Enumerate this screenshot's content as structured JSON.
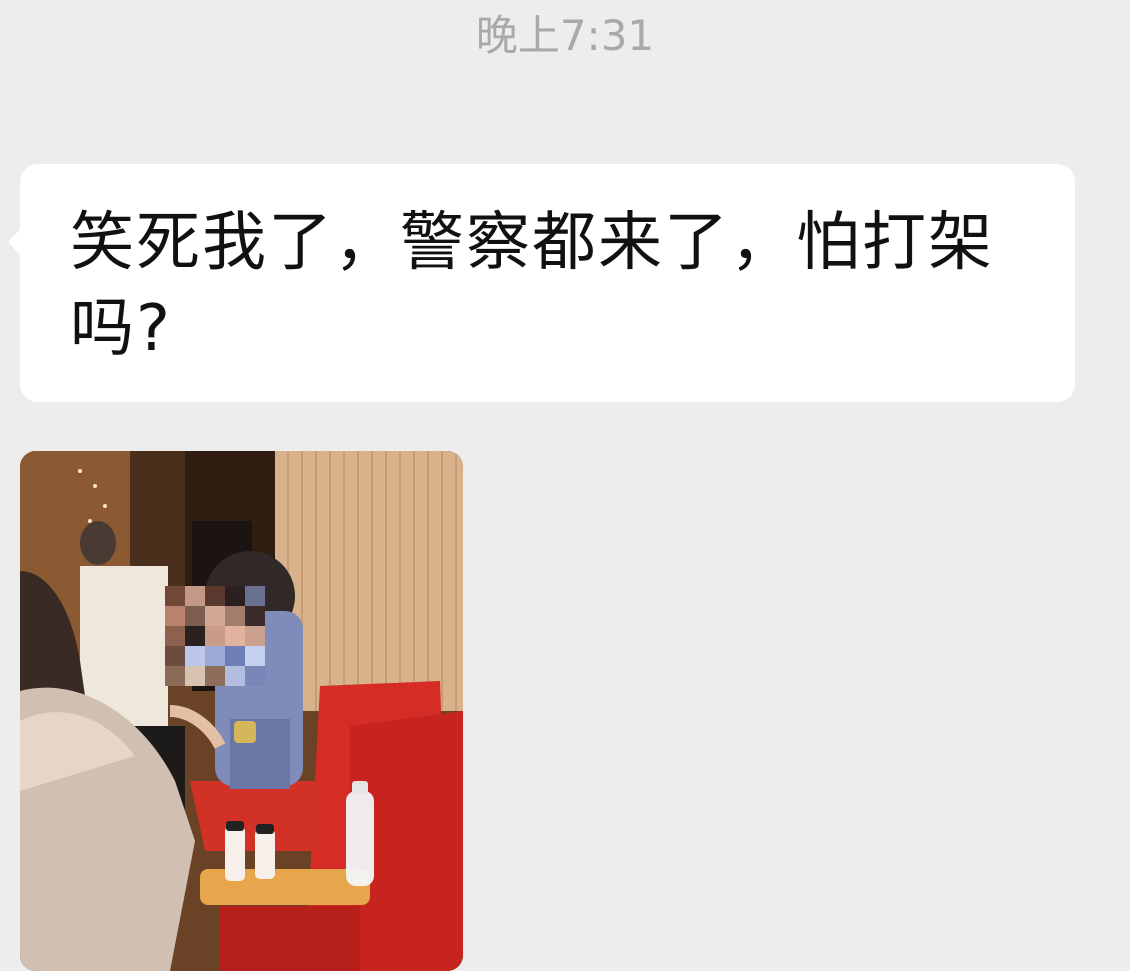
{
  "chat": {
    "timestamp": "晚上7:31",
    "messages": [
      {
        "type": "text",
        "text": "笑死我了，警察都来了，怕打架吗?"
      },
      {
        "type": "image",
        "icon": "photo-thumbnail"
      }
    ]
  }
}
